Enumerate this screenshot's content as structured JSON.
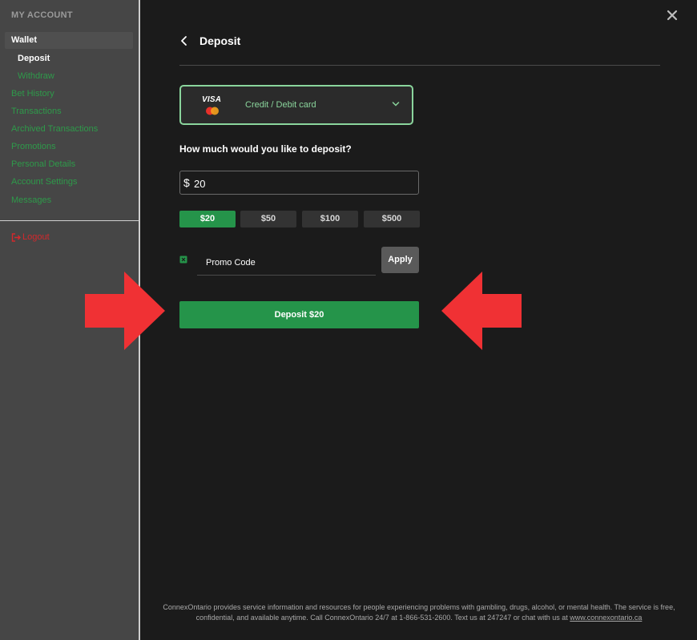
{
  "sidebar": {
    "header": "MY ACCOUNT",
    "wallet": "Wallet",
    "deposit": "Deposit",
    "withdraw": "Withdraw",
    "items": [
      "Bet History",
      "Transactions",
      "Archived Transactions",
      "Promotions",
      "Personal Details",
      "Account Settings",
      "Messages"
    ],
    "logout": "Logout"
  },
  "page": {
    "title": "Deposit"
  },
  "payment": {
    "card_brand": "VISA",
    "method_label": "Credit / Debit card"
  },
  "amount": {
    "question": "How much would you like to deposit?",
    "currency_symbol": "$",
    "value": "20",
    "presets": [
      "$20",
      "$50",
      "$100",
      "$500"
    ],
    "selected_preset": "$20"
  },
  "promo": {
    "placeholder": "Promo Code",
    "apply_label": "Apply"
  },
  "deposit_button": "Deposit $20",
  "colors": {
    "accent_green": "#25944a",
    "border_green": "#8ad59c",
    "arrow_red": "#f03134",
    "logout_red": "#d4282c"
  },
  "footer": {
    "text": "ConnexOntario provides service information and resources for people experiencing problems with gambling, drugs, alcohol, or mental health. The service is free, confidential, and available anytime. Call ConnexOntario 24/7 at 1-866-531-2600. Text us at 247247 or chat with us at ",
    "link": "www.connexontario.ca"
  }
}
